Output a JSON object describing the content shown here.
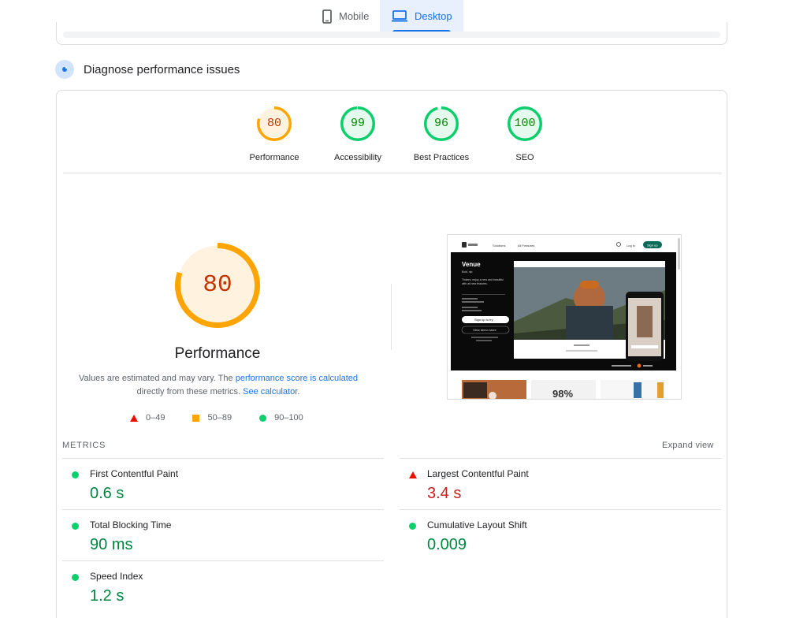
{
  "tabs": [
    {
      "label": "Mobile",
      "icon": "phone-icon",
      "active": false
    },
    {
      "label": "Desktop",
      "icon": "laptop-icon",
      "active": true
    }
  ],
  "section": {
    "title": "Diagnose performance issues"
  },
  "scores": [
    {
      "label": "Performance",
      "value": "80",
      "level": 0.8,
      "color": "#ffa400",
      "text_color": "#c33300"
    },
    {
      "label": "Accessibility",
      "value": "99",
      "level": 0.99,
      "color": "#0cce6b",
      "text_color": "#008800"
    },
    {
      "label": "Best Practices",
      "value": "96",
      "level": 0.96,
      "color": "#0cce6b",
      "text_color": "#008800"
    },
    {
      "label": "SEO",
      "value": "100",
      "level": 1.0,
      "color": "#0cce6b",
      "text_color": "#008800"
    }
  ],
  "main_score": {
    "value": "80",
    "level": 0.8,
    "title": "Performance"
  },
  "description": {
    "prefix": "Values are estimated and may vary. The ",
    "link1": "performance score is calculated",
    "middle": "directly from these metrics. ",
    "link2": "See calculator",
    "suffix": "."
  },
  "legend": [
    {
      "label": "0–49",
      "shape": "triangle",
      "color": "#eb0f00"
    },
    {
      "label": "50–89",
      "shape": "square",
      "color": "#ffa400"
    },
    {
      "label": "90–100",
      "shape": "circle",
      "color": "#0cce6b"
    }
  ],
  "screenshot": {
    "nav_items": [
      "Solutions",
      "All Features"
    ],
    "login": "Log in",
    "signup": "Sign up",
    "hero_title": "Venue",
    "hero_lines": [
      "Bold, sip",
      "Tinkers, enjoy a new and beautiful",
      "with all new features."
    ],
    "btn_primary": "Sign up to try",
    "btn_secondary": "View demo store",
    "percent": "98%"
  },
  "metrics": {
    "heading": "METRICS",
    "expand_label": "Expand view",
    "items": [
      {
        "name": "First Contentful Paint",
        "value": "0.6 s",
        "status": "good"
      },
      {
        "name": "Largest Contentful Paint",
        "value": "3.4 s",
        "status": "bad"
      },
      {
        "name": "Total Blocking Time",
        "value": "90 ms",
        "status": "good"
      },
      {
        "name": "Cumulative Layout Shift",
        "value": "0.009",
        "status": "good"
      },
      {
        "name": "Speed Index",
        "value": "1.2 s",
        "status": "good"
      }
    ]
  }
}
